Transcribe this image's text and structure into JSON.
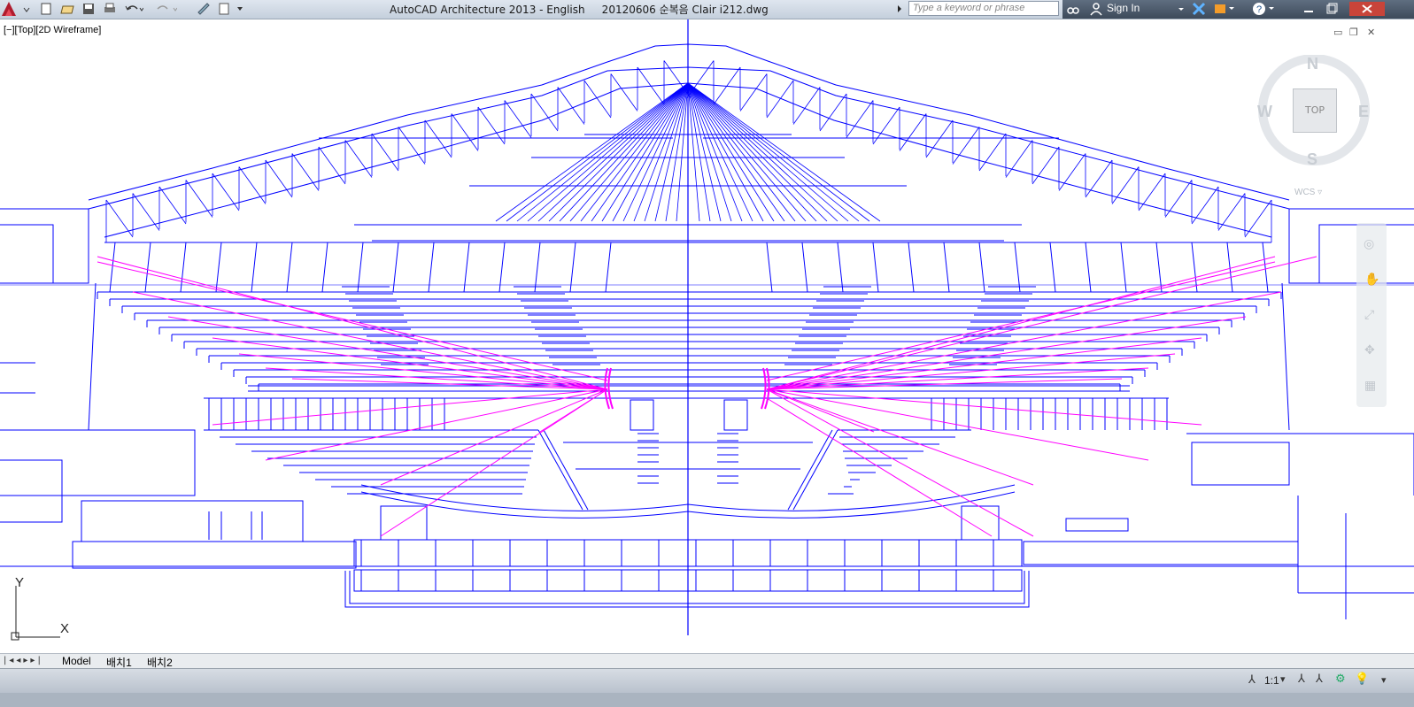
{
  "app": {
    "title": "AutoCAD Architecture 2013 - English     20120606 순복음 Clair i212.dwg",
    "search_placeholder": "Type a keyword or phrase",
    "sign_in": "Sign In"
  },
  "viewport": {
    "label": "[−][Top][2D Wireframe]"
  },
  "viewcube": {
    "north": "N",
    "south": "S",
    "east": "E",
    "west": "W",
    "face": "TOP",
    "ucs": "WCS ▿"
  },
  "ucs_icon": {
    "x_label": "X",
    "y_label": "Y"
  },
  "tabs": [
    {
      "label": "Model"
    },
    {
      "label": "배치1"
    },
    {
      "label": "배치2"
    }
  ],
  "status": {
    "annotation_scale": "1:1"
  },
  "colors": {
    "linework": "#0000ff",
    "highlight": "#ff00ff",
    "titlebar_dark": "#3d4a5a"
  },
  "icons": [
    "app-logo-icon",
    "new-icon",
    "open-icon",
    "save-icon",
    "print-icon",
    "undo-icon",
    "redo-icon",
    "workspace-icon",
    "binoculars-icon",
    "user-icon",
    "exchange-icon",
    "help-icon",
    "minimize-icon",
    "restore-icon",
    "close-icon"
  ]
}
